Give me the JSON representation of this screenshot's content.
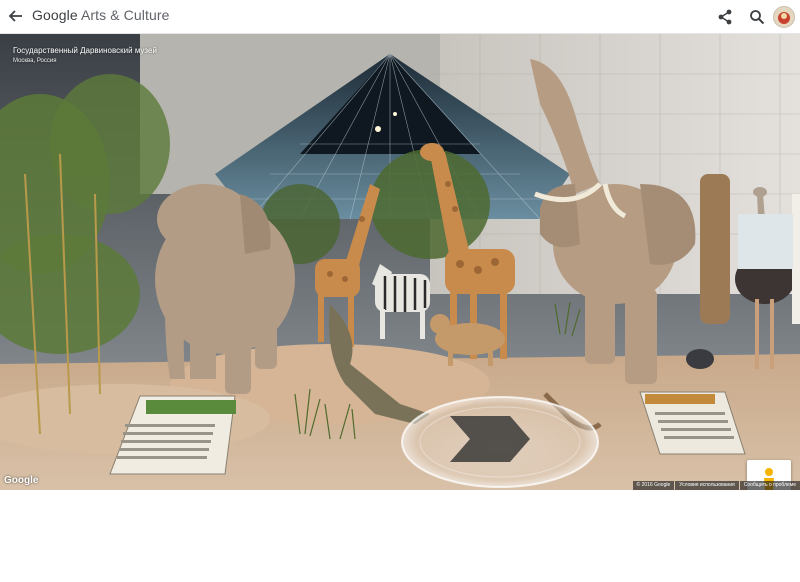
{
  "header": {
    "brand_google": "Google",
    "brand_rest": " Arts & Culture",
    "back_icon": "arrow-left-icon",
    "share_icon": "share-icon",
    "search_icon": "search-icon"
  },
  "viewer": {
    "title": "Государственный Дарвиновский музей",
    "subtitle": "Москва, Россия",
    "logo": "Google",
    "footer": {
      "copyright": "© 2016 Google",
      "terms": "Условия использования",
      "report": "Сообщить о проблеме"
    },
    "colors": {
      "accent": "#1a73e8"
    }
  }
}
